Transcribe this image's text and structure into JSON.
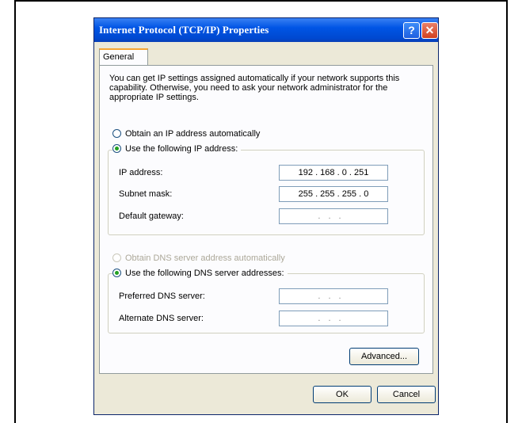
{
  "window": {
    "title": "Internet Protocol (TCP/IP) Properties",
    "help_glyph": "?",
    "close_glyph": "✕"
  },
  "tabs": [
    {
      "label": "General"
    }
  ],
  "intro_text": "You can get IP settings assigned automatically if your network supports this capability. Otherwise, you need to ask your network administrator for the appropriate IP settings.",
  "ip_mode": {
    "auto_label": "Obtain an IP address automatically",
    "auto_selected": false,
    "manual_label": "Use the following IP address:",
    "manual_selected": true
  },
  "ip_fields": {
    "ip_label": "IP address:",
    "ip_value": "192 . 168 .  0  . 251",
    "subnet_label": "Subnet mask:",
    "subnet_value": "255 . 255 . 255 .  0",
    "gateway_label": "Default gateway:",
    "gateway_value": "..."
  },
  "dns_mode": {
    "auto_label": "Obtain DNS server address automatically",
    "auto_enabled": false,
    "manual_label": "Use the following DNS server addresses:",
    "manual_selected": true
  },
  "dns_fields": {
    "preferred_label": "Preferred DNS server:",
    "preferred_value": "...",
    "alternate_label": "Alternate DNS server:",
    "alternate_value": "..."
  },
  "buttons": {
    "advanced": "Advanced...",
    "ok": "OK",
    "cancel": "Cancel"
  }
}
